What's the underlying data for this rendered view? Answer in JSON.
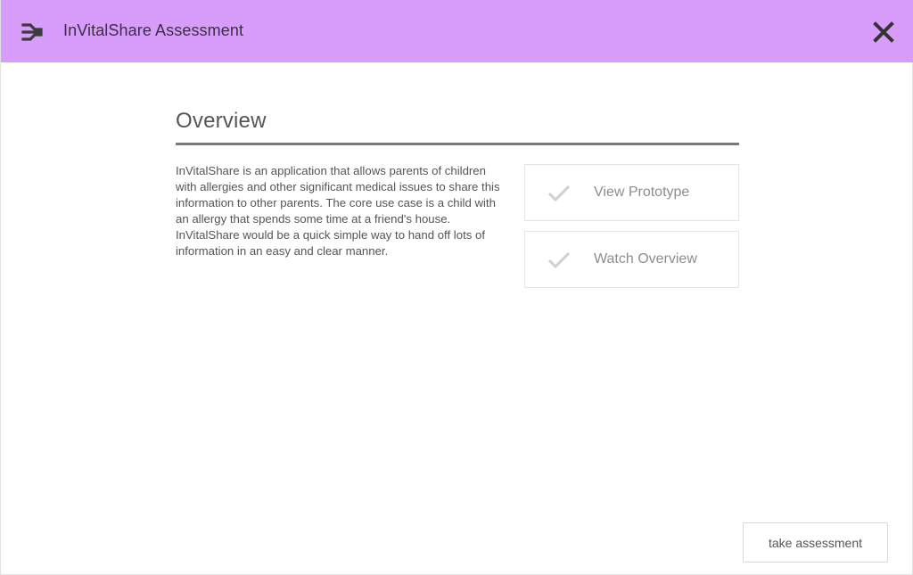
{
  "header": {
    "title": "InVitalShare Assessment",
    "logo_icon": "share-branch-icon",
    "close_icon": "close-icon",
    "background": "#d89cfa"
  },
  "main": {
    "title": "Overview",
    "description": "InVitalShare is an application that allows parents of children with allergies and other significant medical issues to share this information to other parents. The core use case is a child with an allergy that spends some time at a friend's house. InVitalShare would be a quick simple way to hand off lots of information in an easy and clear manner.",
    "actions": [
      {
        "label": "View Prototype",
        "icon": "check-icon"
      },
      {
        "label": "Watch Overview",
        "icon": "check-icon"
      }
    ]
  },
  "footer": {
    "assessment_button": "take assessment"
  }
}
